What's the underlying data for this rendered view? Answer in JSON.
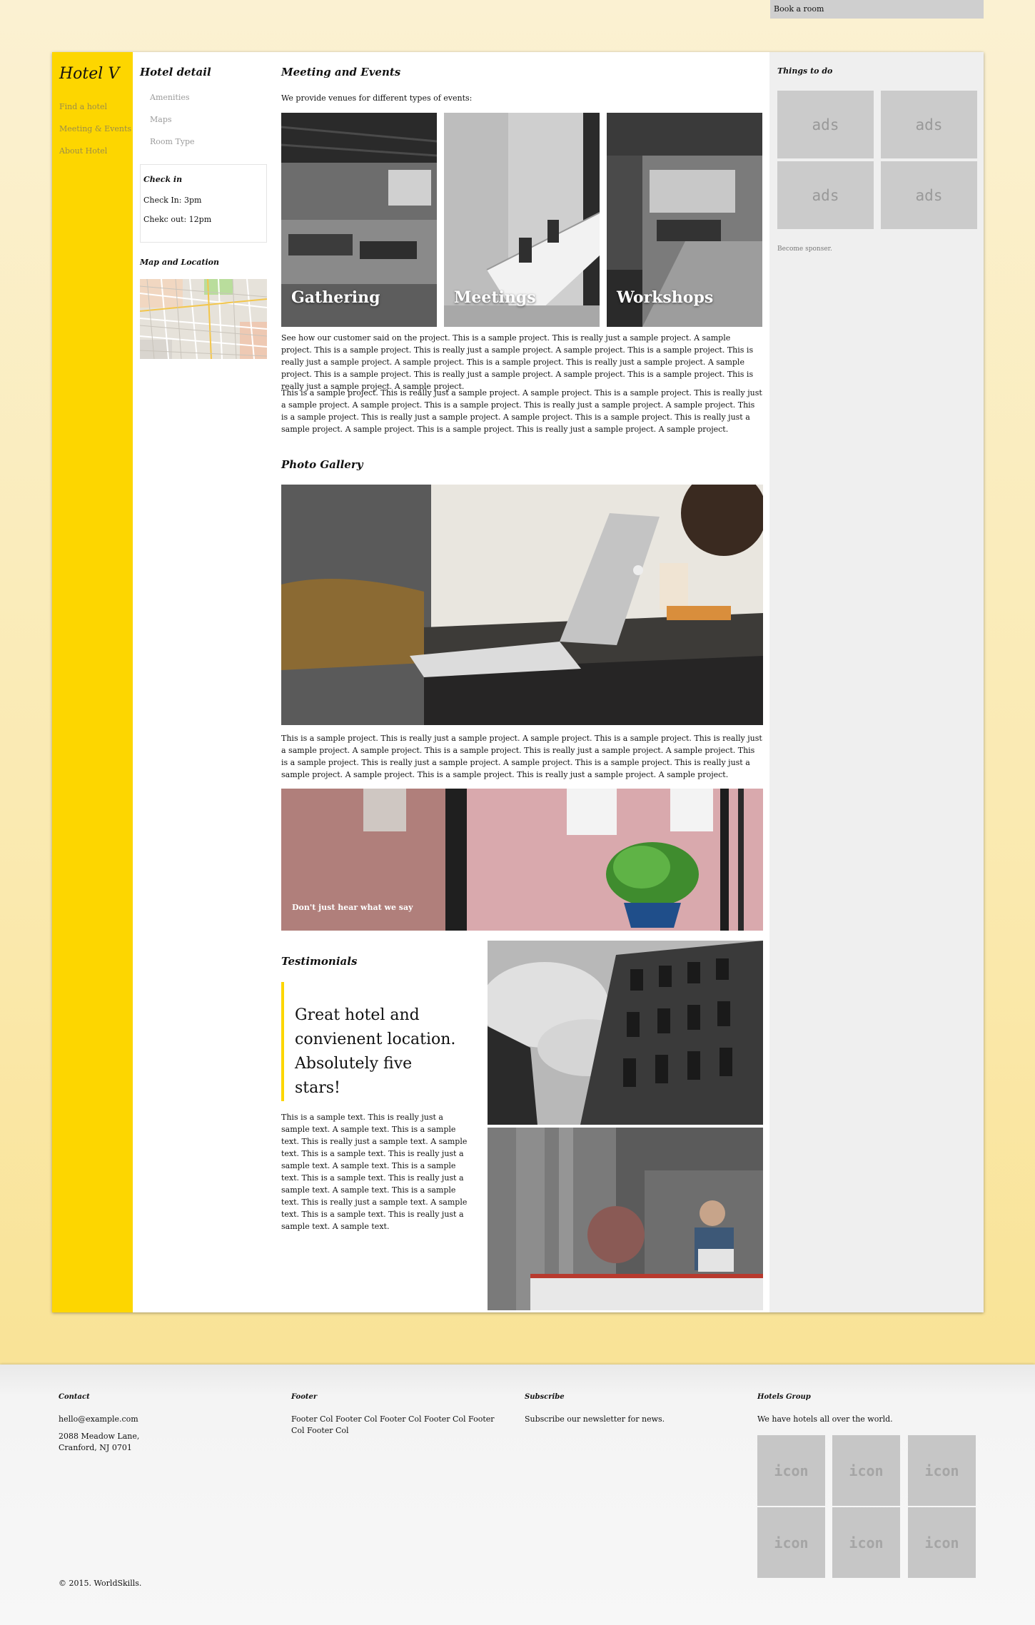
{
  "top": {
    "book_label": "Book a room"
  },
  "brand": {
    "name": "Hotel V"
  },
  "nav": [
    {
      "label": "Find a hotel"
    },
    {
      "label": "Meeting & Events"
    },
    {
      "label": "About Hotel"
    }
  ],
  "detail": {
    "title": "Hotel detail",
    "menu": [
      {
        "label": "Amenities"
      },
      {
        "label": "Maps"
      },
      {
        "label": "Room Type"
      }
    ],
    "checkin_title": "Check in",
    "checkin_in": "Check In: 3pm",
    "checkin_out": "Chekc out: 12pm",
    "map_title": "Map and Location"
  },
  "meeting": {
    "title": "Meeting and Events",
    "intro": "We provide venues for different types of events:",
    "tiles": [
      {
        "label": "Gathering"
      },
      {
        "label": "Meetings"
      },
      {
        "label": "Workshops"
      }
    ],
    "para1": "See how our customer said on the project. This is a sample project. This is really just a sample project. A sample project. This is a sample project. This is really just a sample project. A sample project. This is a sample project. This is really just a sample project. A sample project. This is a sample project. This is really just a sample project. A sample project. This is a sample project. This is really just a sample project. A sample project. This is a sample project. This is really just a sample project. A sample project.",
    "para2": "This is a sample project. This is really just a sample project. A sample project. This is a sample project. This is really just a sample project. A sample project. This is a sample project. This is really just a sample project. A sample project. This is a sample project. This is really just a sample project. A sample project. This is a sample project. This is really just a sample project. A sample project. This is a sample project. This is really just a sample project. A sample project."
  },
  "gallery": {
    "title": "Photo Gallery",
    "para": "This is a sample project. This is really just a sample project. A sample project. This is a sample project. This is really just a sample project. A sample project. This is a sample project. This is really just a sample project. A sample project. This is a sample project. This is really just a sample project. A sample project. This is a sample project. This is really just a sample project. A sample project. This is a sample project. This is really just a sample project. A sample project.",
    "caption": "Don't just hear what we say"
  },
  "testimonials": {
    "title": "Testimonials",
    "quote": "Great hotel and convienent location. Absolutely five stars!",
    "text": "This is a sample text. This is really just a sample text. A sample text. This is a sample text. This is really just a sample text. A sample text. This is a sample text. This is really just a sample text. A sample text. This is a sample text. This is a sample text. This is really just a sample text. A sample text. This is a sample text. This is really just a sample text. A sample text. This is a sample text. This is really just a sample text. A sample text."
  },
  "sidebar": {
    "title": "Things to do",
    "ads": [
      "ads",
      "ads",
      "ads",
      "ads"
    ],
    "sponsor": "Become sponser."
  },
  "footer": {
    "contact_title": "Contact",
    "email": "hello@example.com",
    "address": "2088 Meadow Lane, Cranford, NJ 0701",
    "footer_title": "Footer",
    "footer_text": "Footer Col Footer Col Footer Col Footer Col Footer Col Footer Col",
    "subscribe_title": "Subscribe",
    "subscribe_text": "Subscribe our newsletter for news.",
    "group_title": "Hotels Group",
    "group_text": "We have hotels all over the world.",
    "icons": [
      "icon",
      "icon",
      "icon",
      "icon",
      "icon",
      "icon"
    ],
    "copyright": "© 2015. WorldSkills."
  }
}
